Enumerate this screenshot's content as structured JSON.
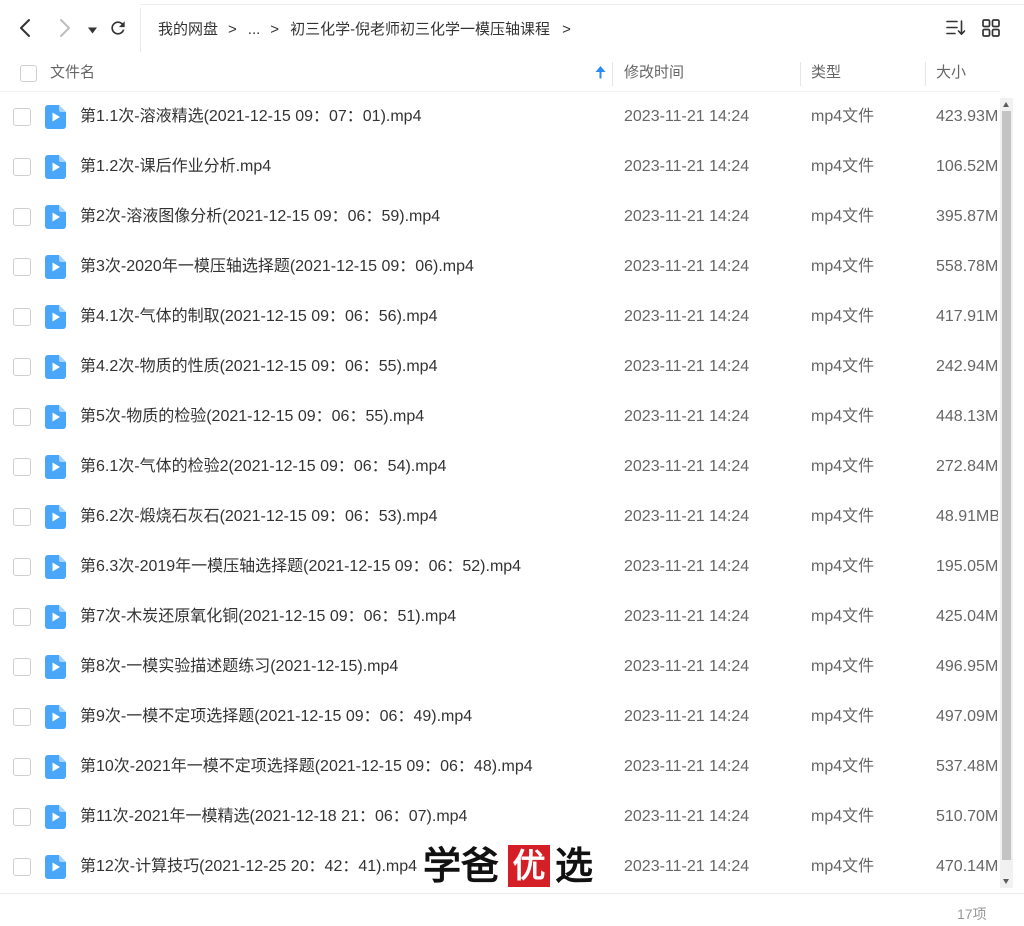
{
  "icons": {
    "back": "chevron-left-icon",
    "forward": "chevron-right-icon",
    "history": "caret-down-icon",
    "refresh": "refresh-icon",
    "sort": "sort-list-icon",
    "view": "grid-view-icon",
    "sort_direction": "arrow-up-icon",
    "file": "video-file-icon"
  },
  "breadcrumb": {
    "root": "我的网盘",
    "separator": ">",
    "ellipsis": "...",
    "current": "初三化学-倪老师初三化学一模压轴课程"
  },
  "columns": {
    "name": "文件名",
    "modified": "修改时间",
    "type": "类型",
    "size": "大小"
  },
  "files": [
    {
      "name": "第1.1次-溶液精选(2021-12-15 09：07：01).mp4",
      "modified": "2023-11-21 14:24",
      "type": "mp4文件",
      "size": "423.93M"
    },
    {
      "name": "第1.2次-课后作业分析.mp4",
      "modified": "2023-11-21 14:24",
      "type": "mp4文件",
      "size": "106.52M"
    },
    {
      "name": "第2次-溶液图像分析(2021-12-15 09：06：59).mp4",
      "modified": "2023-11-21 14:24",
      "type": "mp4文件",
      "size": "395.87M"
    },
    {
      "name": "第3次-2020年一模压轴选择题(2021-12-15 09：06).mp4",
      "modified": "2023-11-21 14:24",
      "type": "mp4文件",
      "size": "558.78M"
    },
    {
      "name": "第4.1次-气体的制取(2021-12-15 09：06：56).mp4",
      "modified": "2023-11-21 14:24",
      "type": "mp4文件",
      "size": "417.91M"
    },
    {
      "name": "第4.2次-物质的性质(2021-12-15 09：06：55).mp4",
      "modified": "2023-11-21 14:24",
      "type": "mp4文件",
      "size": "242.94M"
    },
    {
      "name": "第5次-物质的检验(2021-12-15 09：06：55).mp4",
      "modified": "2023-11-21 14:24",
      "type": "mp4文件",
      "size": "448.13M"
    },
    {
      "name": "第6.1次-气体的检验2(2021-12-15 09：06：54).mp4",
      "modified": "2023-11-21 14:24",
      "type": "mp4文件",
      "size": "272.84M"
    },
    {
      "name": "第6.2次-煅烧石灰石(2021-12-15 09：06：53).mp4",
      "modified": "2023-11-21 14:24",
      "type": "mp4文件",
      "size": "48.91MB"
    },
    {
      "name": "第6.3次-2019年一模压轴选择题(2021-12-15 09：06：52).mp4",
      "modified": "2023-11-21 14:24",
      "type": "mp4文件",
      "size": "195.05M"
    },
    {
      "name": "第7次-木炭还原氧化铜(2021-12-15 09：06：51).mp4",
      "modified": "2023-11-21 14:24",
      "type": "mp4文件",
      "size": "425.04M"
    },
    {
      "name": "第8次-一模实验描述题练习(2021-12-15).mp4",
      "modified": "2023-11-21 14:24",
      "type": "mp4文件",
      "size": "496.95M"
    },
    {
      "name": "第9次-一模不定项选择题(2021-12-15 09：06：49).mp4",
      "modified": "2023-11-21 14:24",
      "type": "mp4文件",
      "size": "497.09M"
    },
    {
      "name": "第10次-2021年一模不定项选择题(2021-12-15 09：06：48).mp4",
      "modified": "2023-11-21 14:24",
      "type": "mp4文件",
      "size": "537.48M"
    },
    {
      "name": "第11次-2021年一模精选(2021-12-18 21：06：07).mp4",
      "modified": "2023-11-21 14:24",
      "type": "mp4文件",
      "size": "510.70M"
    },
    {
      "name": "第12次-计算技巧(2021-12-25 20：42：41).mp4",
      "modified": "2023-11-21 14:24",
      "type": "mp4文件",
      "size": "470.14M"
    }
  ],
  "scroll": {
    "position_percent": 0,
    "visible_percent": 98
  },
  "footer": {
    "count": "17项"
  },
  "watermark": {
    "text_left": "学爸",
    "text_badge": "优",
    "text_right": "选"
  },
  "colors": {
    "accent": "#2a8af6",
    "video_blue": "#4aa6f8",
    "video_fold": "#a9d4fc",
    "badge_red": "#d51f26"
  }
}
